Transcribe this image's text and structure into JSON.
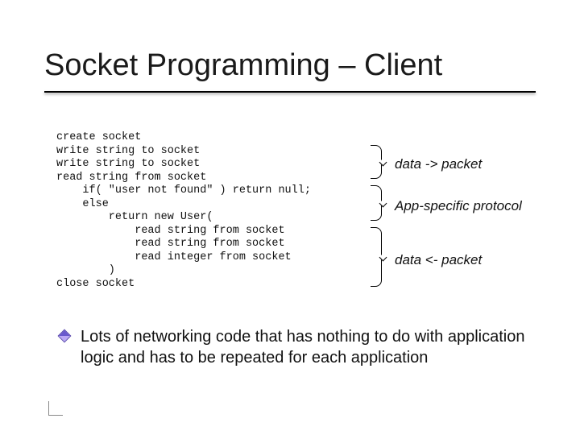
{
  "title": "Socket Programming – Client",
  "code": {
    "l1": "create socket",
    "l2": "write string to socket",
    "l3": "write string to socket",
    "l4": "read string from socket",
    "l5": "    if( \"user not found\" ) return null;",
    "l6": "    else",
    "l7": "        return new User(",
    "l8": "            read string from socket",
    "l9": "            read string from socket",
    "l10": "            read integer from socket",
    "l11": "        )",
    "l12": "close socket"
  },
  "annotations": {
    "a1": "data -> packet",
    "a2": "App-specific protocol",
    "a3": "data <- packet"
  },
  "bullet": "Lots of networking code that has nothing to do with application logic and has to be repeated for each application"
}
